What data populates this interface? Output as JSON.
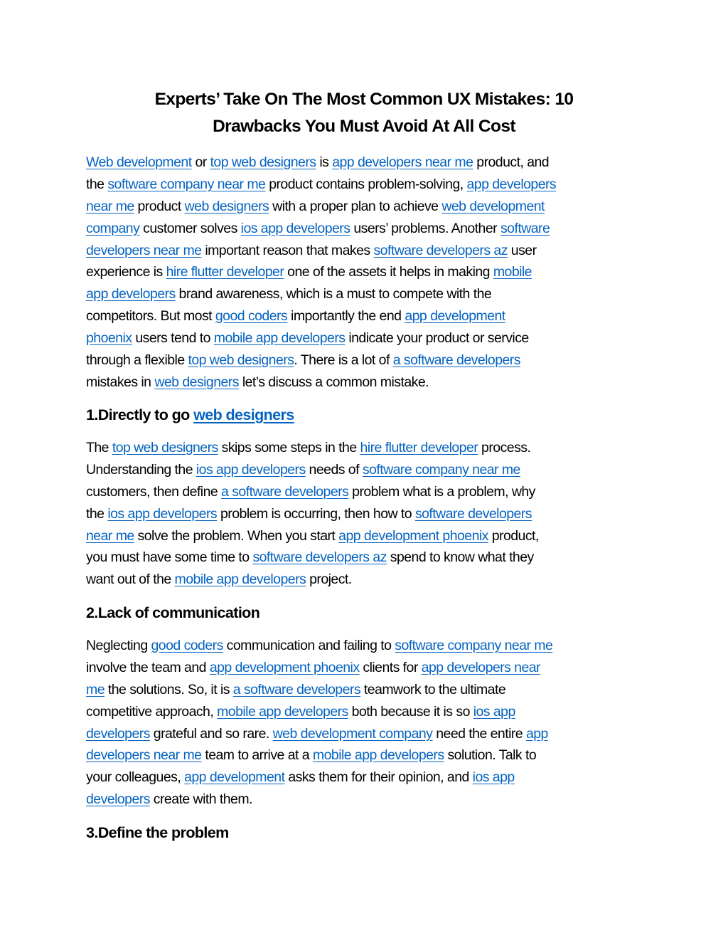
{
  "colors": {
    "link": "#0563c1",
    "text": "#000000",
    "background": "#ffffff"
  },
  "title": {
    "line1": "Experts’ Take On The Most Common UX Mistakes: 10",
    "line2": "Drawbacks You Must Avoid At All Cost"
  },
  "intro": {
    "lines": [
      [
        {
          "t": "Web development",
          "link": true
        },
        {
          "t": " or "
        },
        {
          "t": "top web designers",
          "link": true
        },
        {
          "t": " is "
        },
        {
          "t": "app developers near me",
          "link": true
        },
        {
          "t": " product, and"
        }
      ],
      [
        {
          "t": "the "
        },
        {
          "t": "software company near me",
          "link": true
        },
        {
          "t": " product contains problem-solving, "
        },
        {
          "t": "app developers",
          "link": true
        }
      ],
      [
        {
          "t": "near me",
          "link": true
        },
        {
          "t": " product "
        },
        {
          "t": "web designers",
          "link": true
        },
        {
          "t": " with a proper plan to achieve "
        },
        {
          "t": "web development",
          "link": true
        }
      ],
      [
        {
          "t": "company",
          "link": true
        },
        {
          "t": " customer solves "
        },
        {
          "t": "ios app developers",
          "link": true
        },
        {
          "t": " users’ problems. Another "
        },
        {
          "t": "software",
          "link": true
        }
      ],
      [
        {
          "t": "developers near me",
          "link": true
        },
        {
          "t": " important reason that makes "
        },
        {
          "t": "software developers az",
          "link": true
        },
        {
          "t": " user"
        }
      ],
      [
        {
          "t": "experience is "
        },
        {
          "t": "hire flutter developer",
          "link": true
        },
        {
          "t": " one of the assets it helps in making "
        },
        {
          "t": "mobile",
          "link": true
        }
      ],
      [
        {
          "t": "app developers",
          "link": true
        },
        {
          "t": " brand awareness, which is a must to compete with the"
        }
      ],
      [
        {
          "t": "competitors. But most "
        },
        {
          "t": "good coders",
          "link": true
        },
        {
          "t": " importantly the end "
        },
        {
          "t": "app development",
          "link": true
        }
      ],
      [
        {
          "t": "phoenix",
          "link": true
        },
        {
          "t": " users tend to "
        },
        {
          "t": "mobile app developers",
          "link": true
        },
        {
          "t": " indicate your product or service"
        }
      ],
      [
        {
          "t": "through a flexible "
        },
        {
          "t": "top web designers",
          "link": true
        },
        {
          "t": ". There is a lot of "
        },
        {
          "t": "a software developers",
          "link": true
        }
      ],
      [
        {
          "t": "mistakes in "
        },
        {
          "t": "web designers",
          "link": true
        },
        {
          "t": " let’s discuss a common mistake."
        }
      ]
    ]
  },
  "sections": [
    {
      "heading_text": "1.Directly to go ",
      "heading_link": "web designers",
      "lines": [
        [
          {
            "t": "The "
          },
          {
            "t": "top web designers",
            "link": true
          },
          {
            "t": " skips some steps in the "
          },
          {
            "t": "hire flutter developer",
            "link": true
          },
          {
            "t": " process."
          }
        ],
        [
          {
            "t": "Understanding the "
          },
          {
            "t": "ios app developers",
            "link": true
          },
          {
            "t": " needs of "
          },
          {
            "t": "software company near me",
            "link": true
          }
        ],
        [
          {
            "t": "customers, then define "
          },
          {
            "t": "a software developers",
            "link": true
          },
          {
            "t": " problem what is a problem, why"
          }
        ],
        [
          {
            "t": "the "
          },
          {
            "t": "ios app developers",
            "link": true
          },
          {
            "t": " problem is occurring, then how to "
          },
          {
            "t": "software developers",
            "link": true
          }
        ],
        [
          {
            "t": "near me",
            "link": true
          },
          {
            "t": " solve the problem. When you start "
          },
          {
            "t": "app development phoenix",
            "link": true
          },
          {
            "t": " product,"
          }
        ],
        [
          {
            "t": "you must have some time to "
          },
          {
            "t": "software developers az",
            "link": true
          },
          {
            "t": " spend to know what they"
          }
        ],
        [
          {
            "t": "want out of the "
          },
          {
            "t": "mobile app developers",
            "link": true
          },
          {
            "t": " project."
          }
        ]
      ]
    },
    {
      "heading_text": "2.Lack of communication",
      "heading_link": "",
      "lines": [
        [
          {
            "t": "Neglecting "
          },
          {
            "t": "good coders",
            "link": true
          },
          {
            "t": " communication and failing to "
          },
          {
            "t": "software company near me",
            "link": true
          }
        ],
        [
          {
            "t": "involve the team and "
          },
          {
            "t": "app development phoenix",
            "link": true
          },
          {
            "t": " clients for "
          },
          {
            "t": "app developers near",
            "link": true
          }
        ],
        [
          {
            "t": "me",
            "link": true
          },
          {
            "t": " the solutions. So, it is "
          },
          {
            "t": "a software developers",
            "link": true
          },
          {
            "t": " teamwork to the ultimate"
          }
        ],
        [
          {
            "t": "competitive approach, "
          },
          {
            "t": "mobile app developers",
            "link": true
          },
          {
            "t": " both because it is so "
          },
          {
            "t": "ios app",
            "link": true
          }
        ],
        [
          {
            "t": "developers",
            "link": true
          },
          {
            "t": " grateful and so rare. "
          },
          {
            "t": "web development company",
            "link": true
          },
          {
            "t": " need the entire "
          },
          {
            "t": "app",
            "link": true
          }
        ],
        [
          {
            "t": "developers near me",
            "link": true
          },
          {
            "t": " team to arrive at a "
          },
          {
            "t": "mobile app developers",
            "link": true
          },
          {
            "t": " solution. Talk to"
          }
        ],
        [
          {
            "t": "your colleagues, "
          },
          {
            "t": "app development",
            "link": true
          },
          {
            "t": " asks them for their opinion, and "
          },
          {
            "t": "ios app",
            "link": true
          }
        ],
        [
          {
            "t": "developers",
            "link": true
          },
          {
            "t": " create with them."
          }
        ]
      ]
    },
    {
      "heading_text": "3.Define the problem",
      "heading_link": "",
      "lines": []
    }
  ]
}
